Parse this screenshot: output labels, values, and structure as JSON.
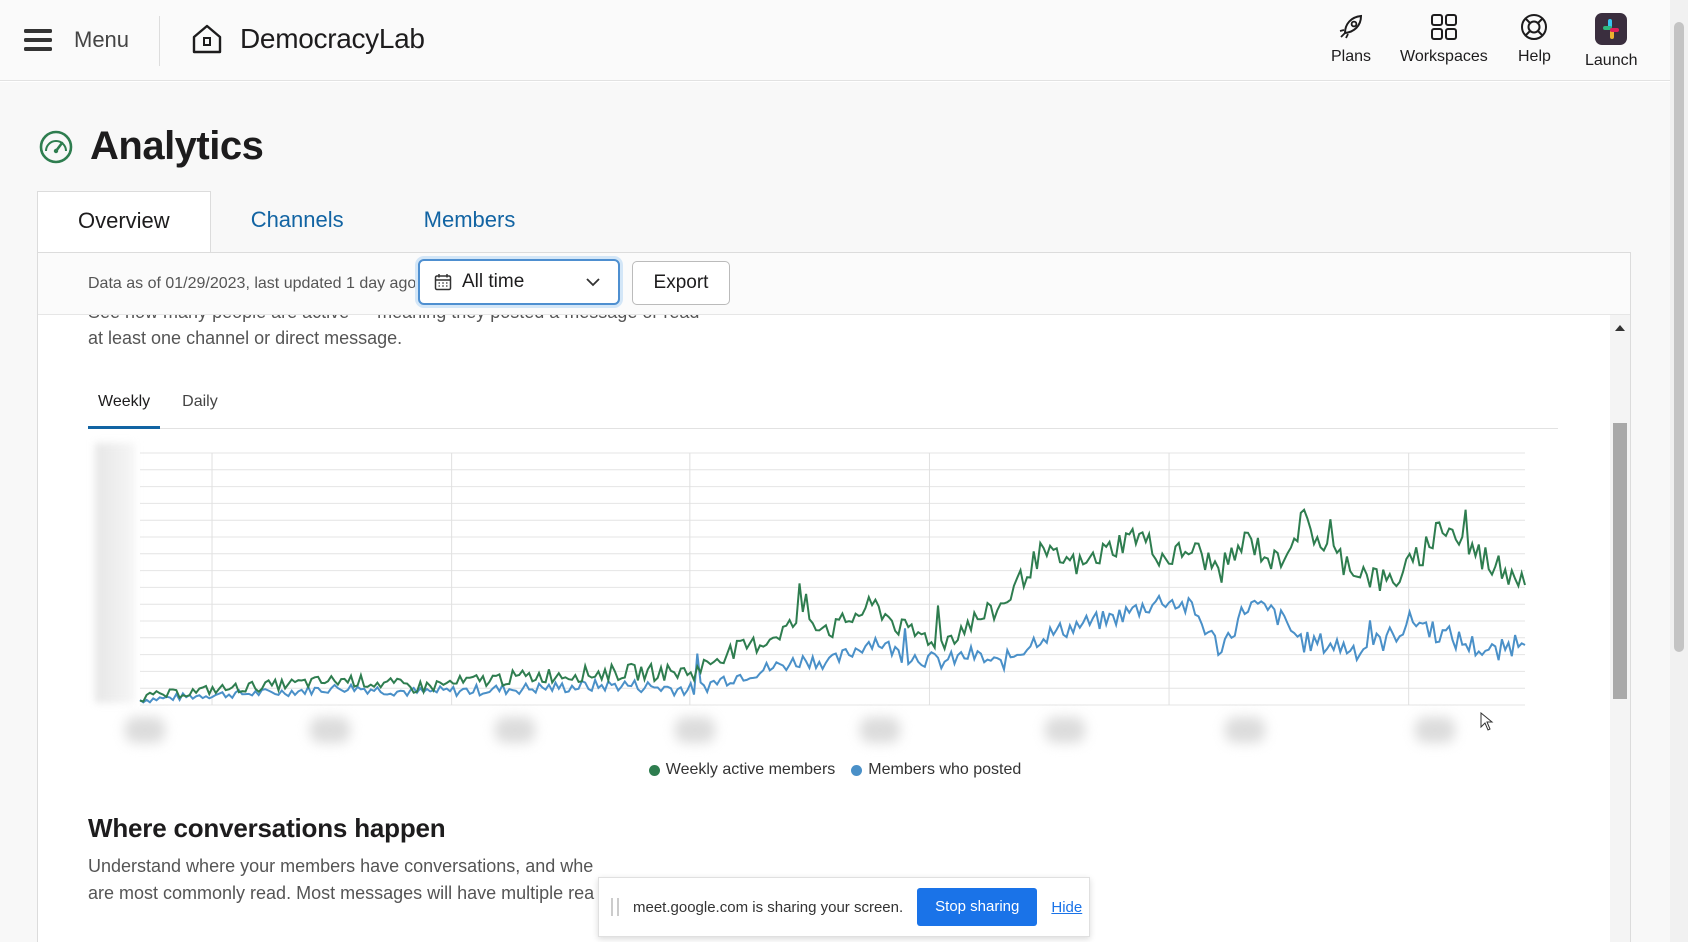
{
  "topbar": {
    "menu_label": "Menu",
    "brand_name": "DemocracyLab",
    "nav": [
      {
        "label": "Plans",
        "icon": "rocket-icon"
      },
      {
        "label": "Workspaces",
        "icon": "grid-icon"
      },
      {
        "label": "Help",
        "icon": "lifebuoy-icon"
      },
      {
        "label": "Launch",
        "icon": "slack-app-icon"
      }
    ]
  },
  "page": {
    "title": "Analytics",
    "title_icon": "gauge-icon",
    "tabs": [
      {
        "label": "Overview",
        "active": true
      },
      {
        "label": "Channels",
        "active": false
      },
      {
        "label": "Members",
        "active": false
      }
    ]
  },
  "filters": {
    "as_of": "Data as of 01/29/2023, last updated 1 day ago",
    "date_range": "All time",
    "export_label": "Export"
  },
  "overview": {
    "description_line1": "See how many people are active — meaning they posted a message or read",
    "description_line2": "at least one channel or direct message.",
    "subtabs": [
      {
        "label": "Weekly",
        "active": true
      },
      {
        "label": "Daily",
        "active": false
      }
    ]
  },
  "chart_data": {
    "type": "line",
    "series": [
      {
        "name": "Weekly active members",
        "color": "#2e7d4f"
      },
      {
        "name": "Members who posted",
        "color": "#4a90c8"
      }
    ],
    "grid": true,
    "legend_position": "bottom-center"
  },
  "conversations": {
    "heading": "Where conversations happen",
    "line1": "Understand where your members have conversations, and whe",
    "line2": "are most commonly read. Most messages will have multiple rea"
  },
  "share_bar": {
    "message": "meet.google.com is sharing your screen.",
    "stop_label": "Stop sharing",
    "hide_label": "Hide"
  },
  "colors": {
    "accent": "#1264a3",
    "green": "#2e7d4f",
    "blue": "#4a90c8",
    "share_blue": "#1a73e8"
  }
}
